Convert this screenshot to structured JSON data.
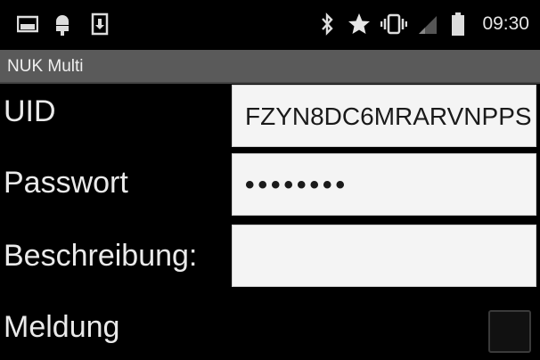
{
  "status_bar": {
    "time": "09:30",
    "icons": [
      "picture-icon",
      "android-icon",
      "download-icon",
      "bluetooth-icon",
      "star-icon",
      "vibrate-icon",
      "signal-icon",
      "battery-icon"
    ]
  },
  "action_bar": {
    "title": "NUK Multi"
  },
  "form": {
    "uid": {
      "label": "UID",
      "value": "FZYN8DC6MRARVNPPS"
    },
    "password": {
      "label": "Passwort",
      "value": "••••••••"
    },
    "description": {
      "label": "Beschreibung:",
      "value": ""
    },
    "message": {
      "label": "Meldung",
      "checked": false
    }
  }
}
